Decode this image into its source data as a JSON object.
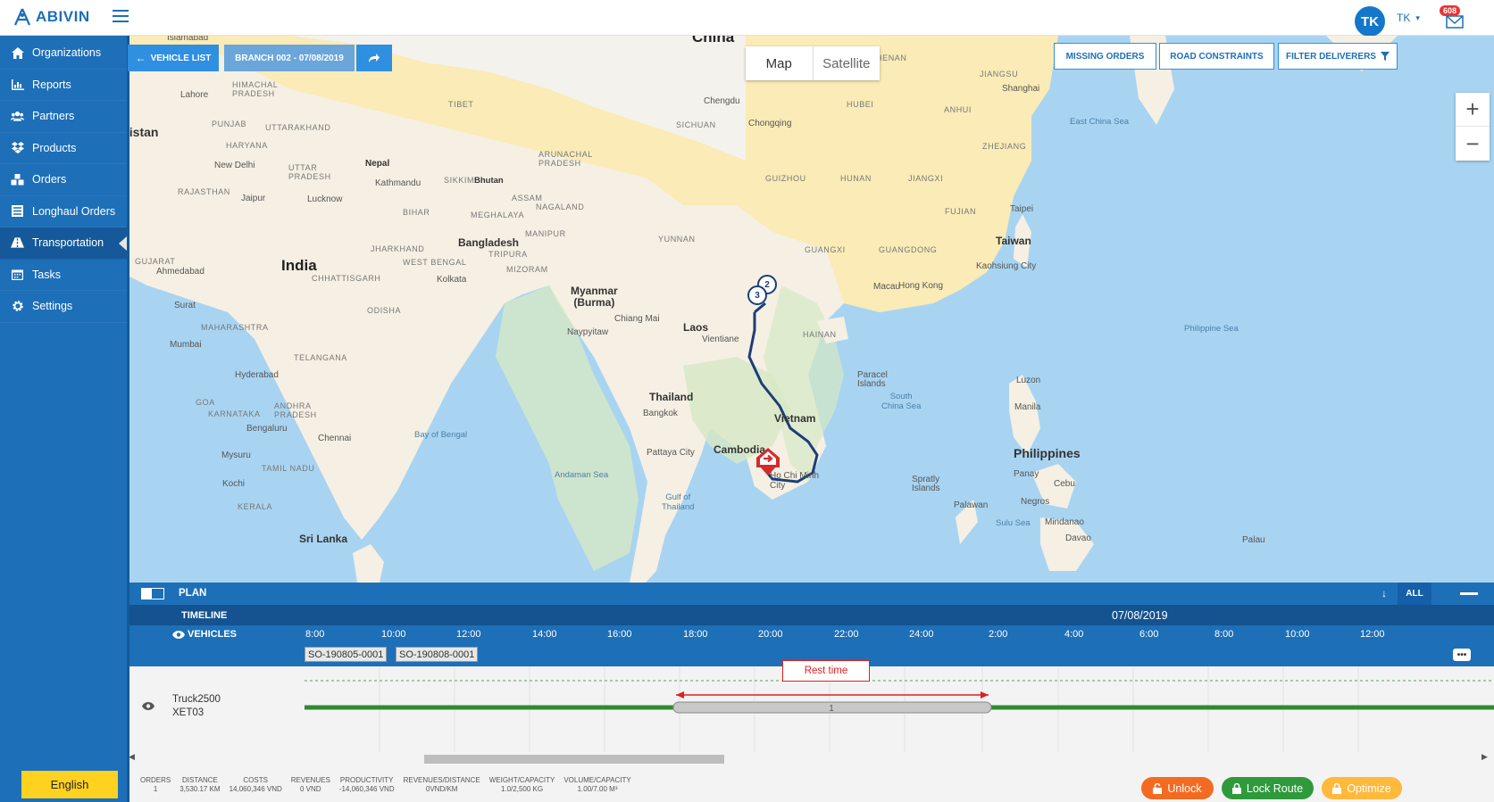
{
  "app": {
    "logo": "ABIVIN"
  },
  "user": {
    "initials": "TK",
    "name": "TK",
    "notifications": "608"
  },
  "sidebar": {
    "items": [
      {
        "label": "Organizations",
        "icon": "home-icon"
      },
      {
        "label": "Reports",
        "icon": "bar-chart-icon"
      },
      {
        "label": "Partners",
        "icon": "users-icon"
      },
      {
        "label": "Products",
        "icon": "dropbox-icon"
      },
      {
        "label": "Orders",
        "icon": "cubes-icon"
      },
      {
        "label": "Longhaul Orders",
        "icon": "list-icon"
      },
      {
        "label": "Transportation",
        "icon": "road-icon",
        "active": true
      },
      {
        "label": "Tasks",
        "icon": "calendar-icon"
      },
      {
        "label": "Settings",
        "icon": "gear-icon"
      }
    ],
    "language": "English"
  },
  "map_controls": {
    "vehicle_list": "VEHICLE LIST",
    "branch": "BRANCH 002 - 07/08/2019",
    "map": "Map",
    "satellite": "Satellite",
    "missing_orders": "MISSING ORDERS",
    "road_constraints": "ROAD CONSTRAINTS",
    "filter_deliverers": "FILTER DELIVERERS",
    "zoom_in": "+",
    "zoom_out": "−"
  },
  "map_labels": {
    "india": "India",
    "china": "China",
    "kistan": "kistan",
    "nepal": "Nepal",
    "bangladesh": "Bangladesh",
    "bhutan": "Bhutan",
    "myanmar": "Myanmar\n(Burma)",
    "laos": "Laos",
    "thailand": "Thailand",
    "cambodia": "Cambodia",
    "vietnam": "Vietnam",
    "philippines": "Philippines",
    "taiwan": "Taiwan",
    "srilanka": "Sri Lanka",
    "bay_bengal": "Bay of Bengal",
    "andaman": "Andaman Sea",
    "gulf_thailand": "Gulf of\nThailand",
    "south_china_sea": "South\nChina Sea",
    "east_china_sea": "East China Sea",
    "philippine_sea": "Philippine Sea",
    "sulu": "Sulu Sea",
    "cities": [
      "Islamabad",
      "Lahore",
      "New Delhi",
      "Jaipur",
      "Lucknow",
      "Kathmandu",
      "Ahmedabad",
      "Surat",
      "Mumbai",
      "Hyderabad",
      "Bengaluru",
      "Chennai",
      "Mysuru",
      "Kochi",
      "Kolkata",
      "Chengdu",
      "Chongqing",
      "Shanghai",
      "Taipei",
      "Kaohsiung City",
      "Macau",
      "Hong Kong",
      "Chiang Mai",
      "Naypyitaw",
      "Vientiane",
      "Bangkok",
      "Pattaya City",
      "Ho Chi Minh City",
      "Manila",
      "Luzon",
      "Panay",
      "Cebu",
      "Negros",
      "Mindanao",
      "Davao",
      "Palawan",
      "Palau",
      "Paracel Islands",
      "Spratly Islands"
    ],
    "provinces": [
      "HIMACHAL PRADESH",
      "PUNJAB",
      "UTTARAKHAND",
      "HARYANA",
      "UTTAR PRADESH",
      "RAJASTHAN",
      "BIHAR",
      "GUJARAT",
      "CHHATTISGARH",
      "JHARKHAND",
      "WEST BENGAL",
      "ODISHA",
      "MAHARASHTRA",
      "TELANGANA",
      "GOA",
      "KARNATAKA",
      "ANDHRA PRADESH",
      "TAMIL NADU",
      "KERALA",
      "ARUNACHAL PRADESH",
      "SIKKIM",
      "ASSAM",
      "NAGALAND",
      "MEGHALAYA",
      "MANIPUR",
      "TRIPURA",
      "MIZORAM",
      "TIBET",
      "HENAN",
      "JIANGSU",
      "ANHUI",
      "HUBEI",
      "SICHUAN",
      "ZHEJIANG",
      "HUNAN",
      "JIANGXI",
      "GUIZHOU",
      "FUJIAN",
      "YUNNAN",
      "GUANGXI",
      "GUANGDONG",
      "HAINAN"
    ],
    "markers": [
      "2",
      "3"
    ]
  },
  "plan": {
    "title": "PLAN",
    "all": "ALL",
    "timeline_label": "TIMELINE",
    "vehicles_label": "VEHICLES",
    "date": "07/08/2019",
    "hours": [
      "8:00",
      "10:00",
      "12:00",
      "14:00",
      "16:00",
      "18:00",
      "20:00",
      "22:00",
      "24:00",
      "2:00",
      "4:00",
      "6:00",
      "8:00",
      "10:00",
      "12:00"
    ],
    "orders": [
      "SO-190805-0001",
      "SO-190808-0001"
    ],
    "rest_time": "Rest time",
    "vehicle": {
      "name": "Truck2500",
      "code": "XET03",
      "route_index": "1"
    }
  },
  "stats": [
    {
      "label": "ORDERS",
      "value": "1"
    },
    {
      "label": "DISTANCE",
      "value": "3,530.17 KM"
    },
    {
      "label": "COSTS",
      "value": "14,060,346 VND"
    },
    {
      "label": "REVENUES",
      "value": "0 VND"
    },
    {
      "label": "PRODUCTIVITY",
      "value": "-14,060,346 VND"
    },
    {
      "label": "REVENUES/DISTANCE",
      "value": "0VND/KM"
    },
    {
      "label": "WEIGHT/CAPACITY",
      "value": "1.0/2,500 KG"
    },
    {
      "label": "VOLUME/CAPACITY",
      "value": "1.00/7.00 M³"
    }
  ],
  "actions": {
    "unlock": "Unlock",
    "lock_route": "Lock Route",
    "optimize": "Optimize"
  },
  "colors": {
    "primary": "#1d6fb8",
    "unlock": "#f36b21",
    "lock": "#2e9a3b",
    "optimize": "#ffb93b",
    "route": "#1b3e78"
  }
}
